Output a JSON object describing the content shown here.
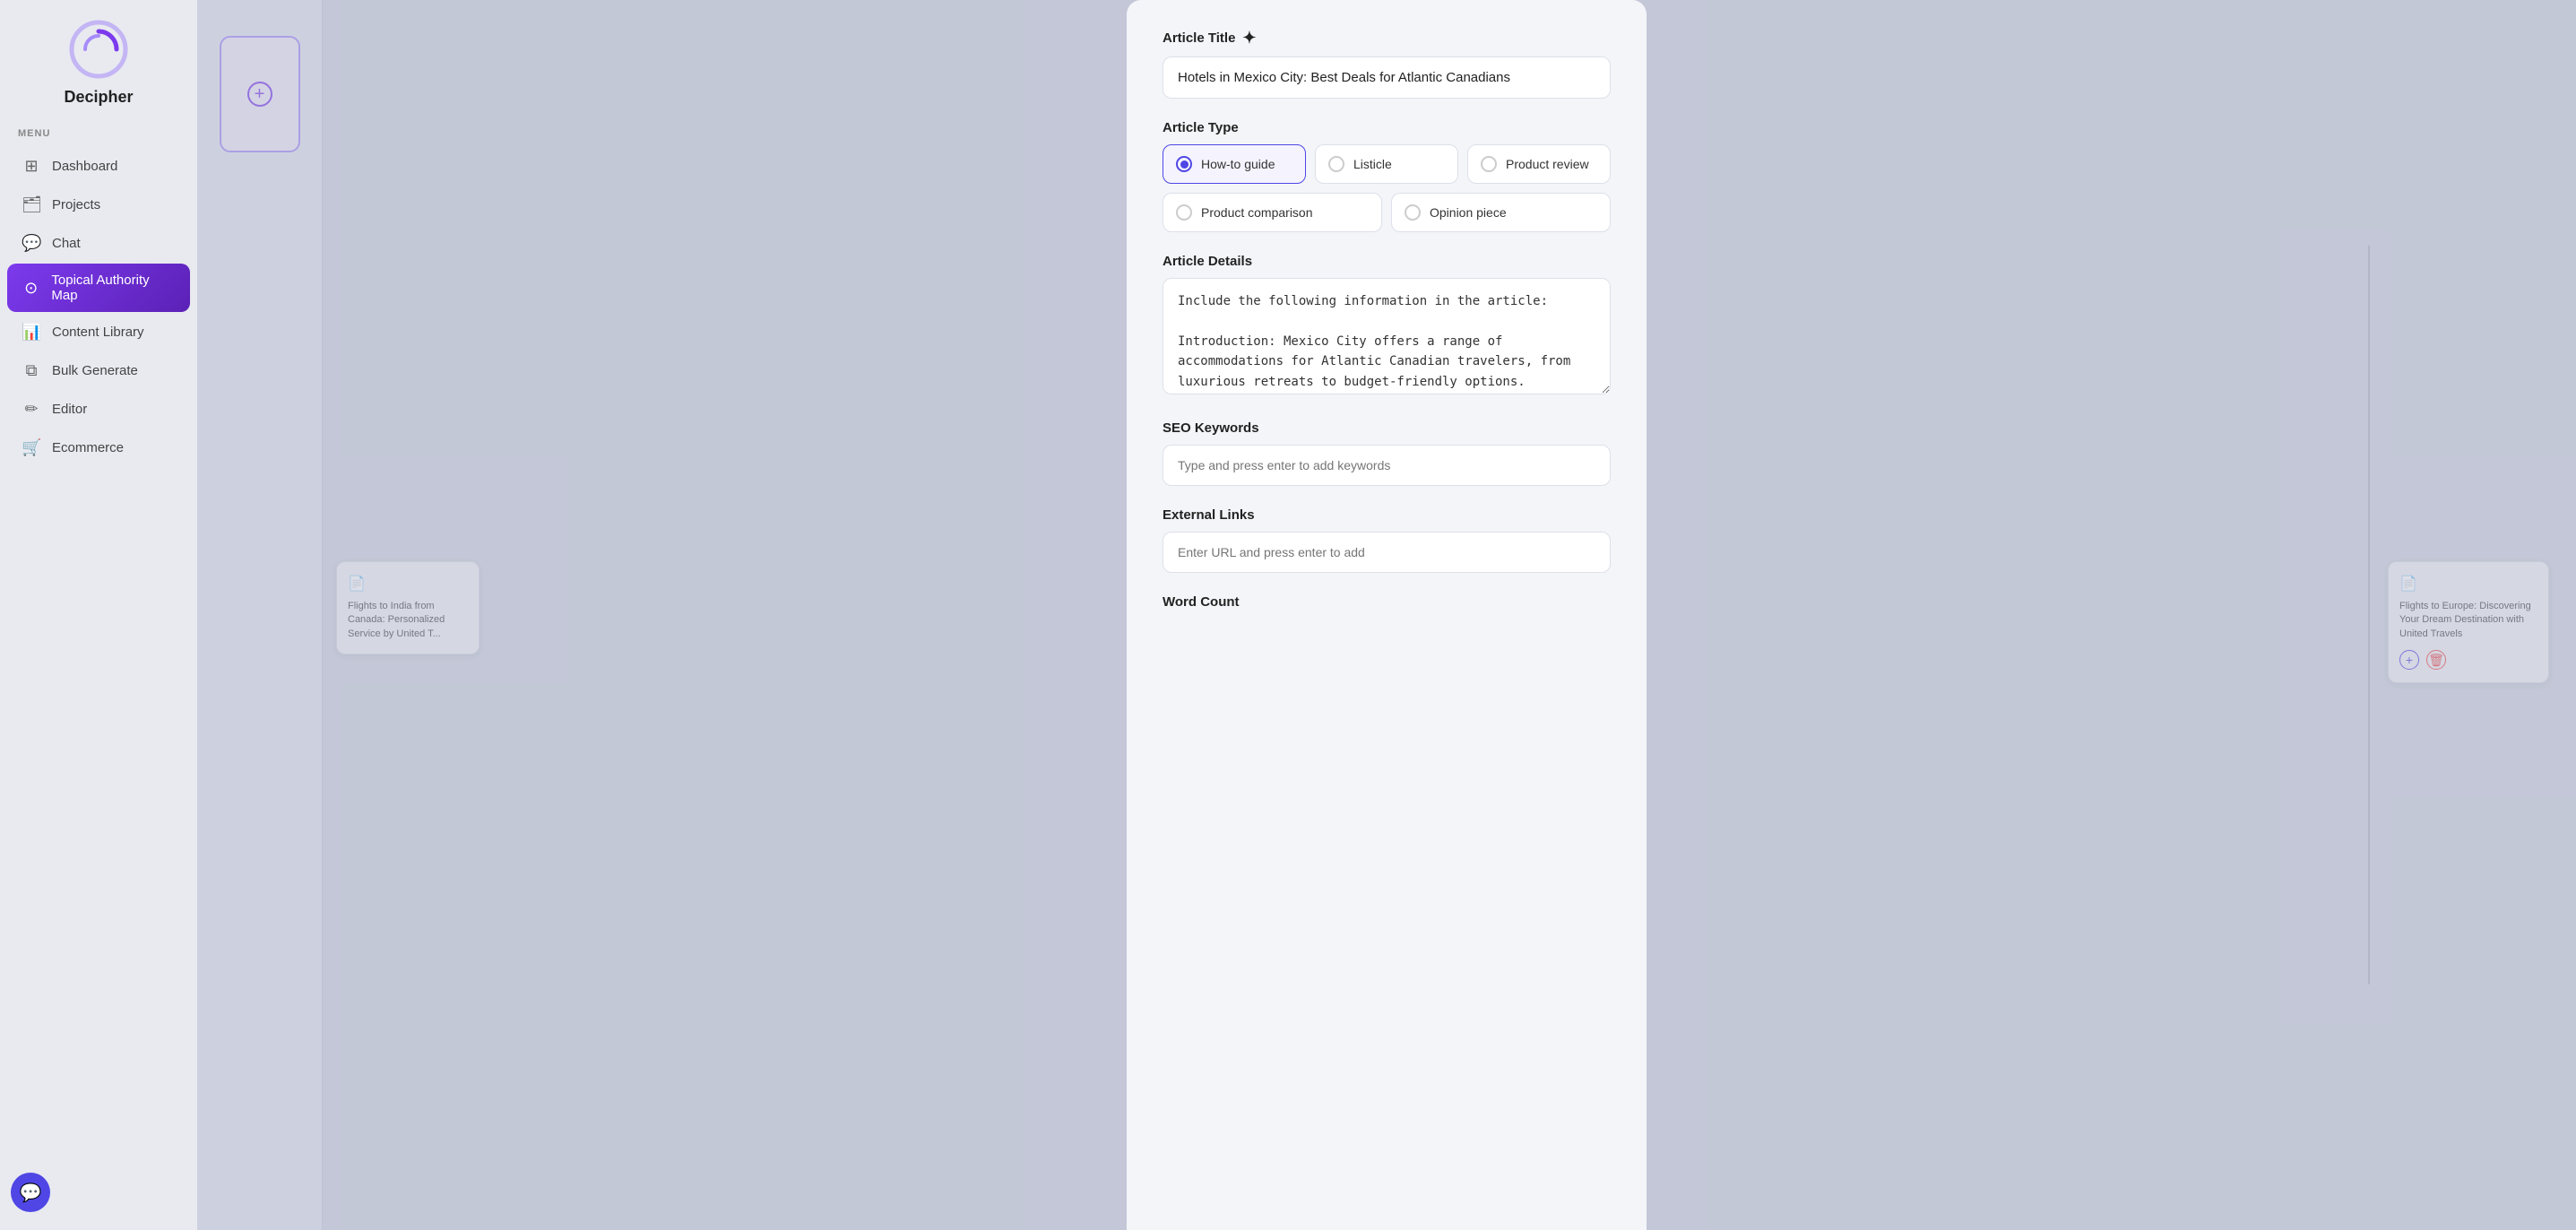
{
  "app": {
    "name": "Decipher"
  },
  "sidebar": {
    "menu_label": "MENU",
    "items": [
      {
        "id": "dashboard",
        "label": "Dashboard",
        "icon": "⊞",
        "active": false
      },
      {
        "id": "projects",
        "label": "Projects",
        "icon": "🗂",
        "active": false
      },
      {
        "id": "chat",
        "label": "Chat",
        "icon": "💬",
        "active": false
      },
      {
        "id": "topical-authority-map",
        "label": "Topical Authority Map",
        "icon": "⊙",
        "active": true
      },
      {
        "id": "content-library",
        "label": "Content Library",
        "icon": "📊",
        "active": false
      },
      {
        "id": "bulk-generate",
        "label": "Bulk Generate",
        "icon": "⧉",
        "active": false
      },
      {
        "id": "editor",
        "label": "Editor",
        "icon": "✏",
        "active": false
      },
      {
        "id": "ecommerce",
        "label": "Ecommerce",
        "icon": "🛒",
        "active": false
      }
    ],
    "chat_bubble_icon": "💬"
  },
  "bg_card_left": {
    "text": "Flights to India from Canada: Personalized Service by United T...",
    "icon": "📄"
  },
  "bg_card_right": {
    "text": "Flights to Europe: Discovering Your Dream Destination with United Travels",
    "icon": "📄"
  },
  "modal": {
    "article_title_label": "Article Title",
    "article_title_value": "Hotels in Mexico City: Best Deals for Atlantic Canadians",
    "article_title_sparkle": "✦",
    "article_type_label": "Article Type",
    "article_types": [
      {
        "id": "how-to-guide",
        "label": "How-to guide",
        "selected": true
      },
      {
        "id": "listicle",
        "label": "Listicle",
        "selected": false
      },
      {
        "id": "product-review",
        "label": "Product review",
        "selected": false
      },
      {
        "id": "product-comparison",
        "label": "Product comparison",
        "selected": false
      },
      {
        "id": "opinion-piece",
        "label": "Opinion piece",
        "selected": false
      }
    ],
    "article_details_label": "Article Details",
    "article_details_value": "Include the following information in the article:\n\nIntroduction: Mexico City offers a range of accommodations for Atlantic Canadian travelers, from luxurious retreats to budget-friendly options.",
    "seo_keywords_label": "SEO Keywords",
    "seo_keywords_placeholder": "Type and press enter to add keywords",
    "external_links_label": "External Links",
    "external_links_placeholder": "Enter URL and press enter to add",
    "word_count_label": "Word Count"
  }
}
